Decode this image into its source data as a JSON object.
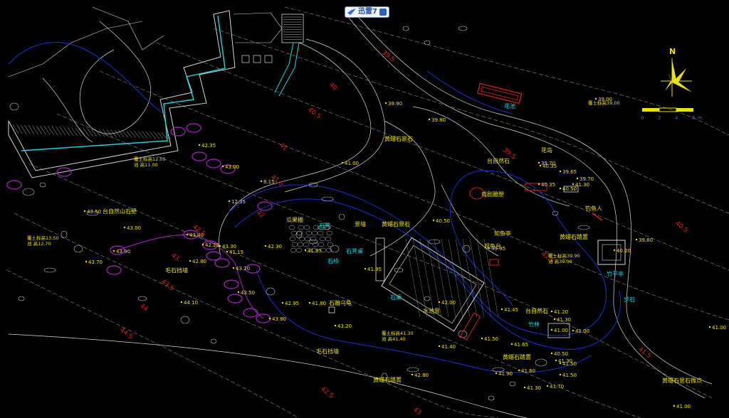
{
  "badge": {
    "name": "迅雷7"
  },
  "north": "N",
  "scale": {
    "ticks": [
      "0",
      "2",
      "4",
      "6"
    ],
    "unit": "m"
  },
  "colors": {
    "yellow": "#e8e01a",
    "cyan": "#18d8e0",
    "red": "#d8201e",
    "blue": "#1c2fd0",
    "magenta": "#b020c8",
    "white": "#d8d8d8"
  },
  "labels_yellow": [
    "40.35",
    "39.70",
    "40.35",
    "40.50",
    "39.65",
    "39.70",
    "39.90",
    "39.80",
    "39.80",
    "41.00",
    "40.50",
    "39.95",
    "40.20",
    "39.00",
    "42.35",
    "43.00",
    "8.15",
    "12.35",
    "43.50",
    "43.00",
    "43.40",
    "42.25",
    "43.30",
    "42.80",
    "43.90",
    "43.70",
    "42.30",
    "41.15",
    "41.95",
    "43.20",
    "43.50",
    "44.10",
    "42.95",
    "41.95",
    "43.80",
    "41.80",
    "43.20",
    "41.50",
    "42.80",
    "41.40",
    "41.65",
    "42.00",
    "41.00",
    "41.45",
    "41.30",
    "41.20",
    "41.00",
    "41.50",
    "41.90",
    "41.60",
    "41.30",
    "41.70",
    "41.30",
    "41.50",
    "40.50",
    "41.00",
    "41.00",
    "41.30"
  ],
  "labels_contour_red": [
    "39.5",
    "40",
    "40.5",
    "41",
    "41.5",
    "42",
    "42.5",
    "43",
    "43.5",
    "44",
    "44.5",
    "39.5",
    "42.5",
    "43",
    "41.5",
    "42.5",
    "40.5"
  ],
  "labels_map_text": [
    {
      "text": "花池",
      "c": "cyan"
    },
    {
      "text": "花岛",
      "c": "yellow"
    },
    {
      "text": "台自然石",
      "c": "yellow"
    },
    {
      "text": "黄蜡石景石",
      "c": "yellow"
    },
    {
      "text": "黄蜡石景石",
      "c": "yellow"
    },
    {
      "text": "戏剧雕塑",
      "c": "yellow"
    },
    {
      "text": "瓜果棚",
      "c": "yellow"
    },
    {
      "text": "石凳",
      "c": "cyan"
    },
    {
      "text": "景墙",
      "c": "yellow"
    },
    {
      "text": "石凳桌",
      "c": "cyan"
    },
    {
      "text": "石桥",
      "c": "cyan"
    },
    {
      "text": "石桌",
      "c": "cyan"
    },
    {
      "text": "水池景",
      "c": "yellow"
    },
    {
      "text": "石雕乌龟",
      "c": "yellow"
    },
    {
      "text": "毛石挡墙",
      "c": "yellow"
    },
    {
      "text": "毛石挡墙",
      "c": "yellow"
    },
    {
      "text": "台自然山石壁",
      "c": "yellow"
    },
    {
      "text": "台自然石",
      "c": "yellow"
    },
    {
      "text": "竹林",
      "c": "cyan"
    },
    {
      "text": "观鱼台",
      "c": "yellow"
    },
    {
      "text": "知鱼亭",
      "c": "yellow"
    },
    {
      "text": "钓鱼人",
      "c": "yellow"
    },
    {
      "text": "黄蜡石踏置",
      "c": "yellow"
    },
    {
      "text": "步石",
      "c": "cyan"
    },
    {
      "text": "竹平亭",
      "c": "cyan"
    },
    {
      "text": "黄蜡石踏置",
      "c": "yellow"
    },
    {
      "text": "黄蜡石踏置",
      "c": "yellow"
    },
    {
      "text": "黄蜡石景石微点",
      "c": "yellow"
    }
  ],
  "elevation_notes": [
    {
      "line1": "覆土标高13.50",
      "line2": "池   高12.70"
    },
    {
      "line1": "覆土标高12.05",
      "line2": "池   高11.00"
    },
    {
      "line1": "覆土标高41.30",
      "line2": "池   高41.40"
    },
    {
      "line1": "覆土标高39.90",
      "line2": "池   高39.00"
    },
    {
      "line1": "覆土标高39.00",
      "line2": ""
    }
  ]
}
